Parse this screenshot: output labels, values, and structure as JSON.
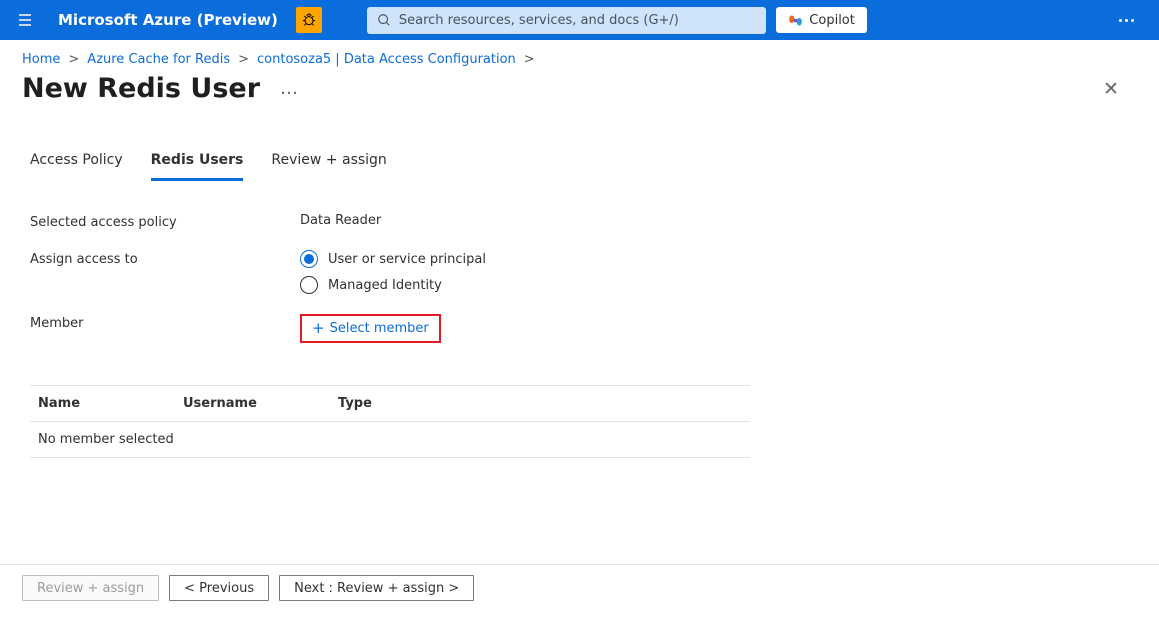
{
  "header": {
    "brand": "Microsoft Azure (Preview)",
    "search_placeholder": "Search resources, services, and docs (G+/)",
    "copilot_label": "Copilot"
  },
  "breadcrumb": {
    "items": [
      {
        "label": "Home"
      },
      {
        "label": "Azure Cache for Redis"
      },
      {
        "label": "contosoza5 | Data Access Configuration"
      }
    ]
  },
  "page": {
    "title": "New Redis User"
  },
  "tabs": [
    {
      "label": "Access Policy",
      "active": false
    },
    {
      "label": "Redis Users",
      "active": true
    },
    {
      "label": "Review + assign",
      "active": false
    }
  ],
  "form": {
    "selected_access_policy_label": "Selected access policy",
    "selected_access_policy_value": "Data Reader",
    "assign_access_label": "Assign access to",
    "radio_options": [
      {
        "label": "User or service principal",
        "selected": true
      },
      {
        "label": "Managed Identity",
        "selected": false
      }
    ],
    "member_label": "Member",
    "select_member_label": "Select member"
  },
  "table": {
    "columns": {
      "name": "Name",
      "username": "Username",
      "type": "Type"
    },
    "empty_row": "No member selected"
  },
  "footer": {
    "review_assign": "Review + assign",
    "previous": "< Previous",
    "next": "Next : Review + assign >"
  }
}
